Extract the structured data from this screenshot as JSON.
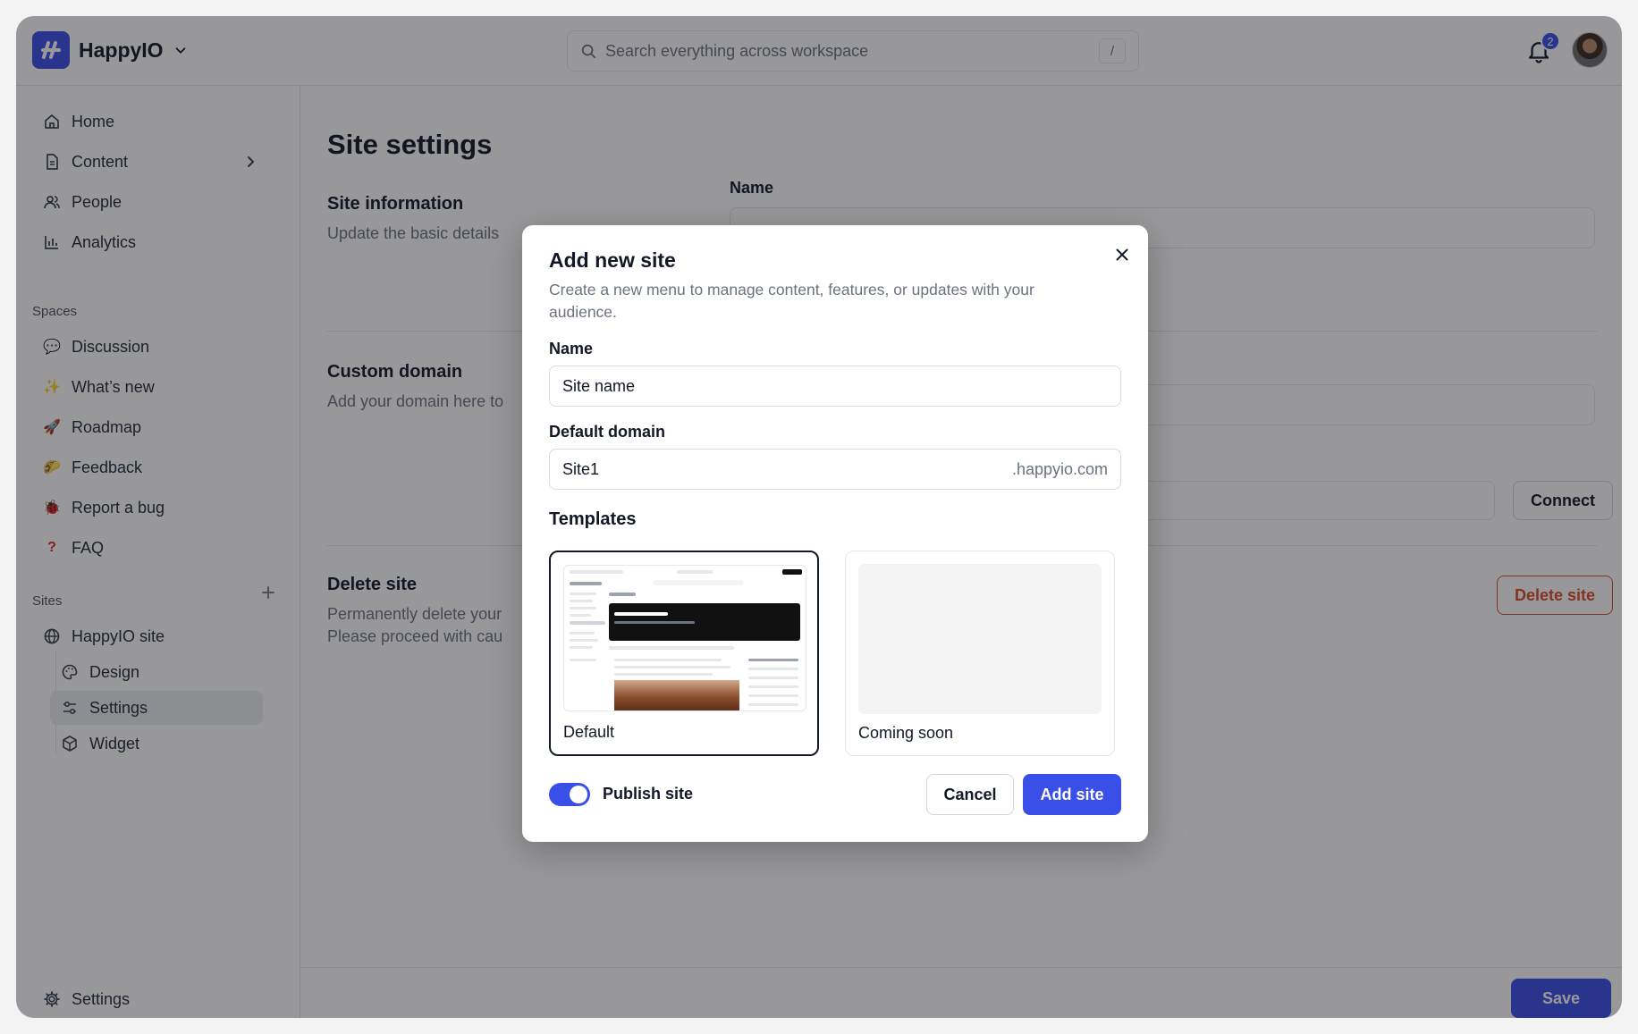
{
  "app": {
    "name": "HappyIO"
  },
  "search": {
    "placeholder": "Search everything across workspace",
    "shortcut": "/"
  },
  "notifications": {
    "count": "2"
  },
  "sidebar": {
    "main_items": [
      {
        "label": "Home",
        "icon": "home-icon"
      },
      {
        "label": "Content",
        "icon": "document-icon"
      },
      {
        "label": "People",
        "icon": "people-icon"
      },
      {
        "label": "Analytics",
        "icon": "chart-icon"
      }
    ],
    "spaces_label": "Spaces",
    "spaces": [
      {
        "label": "Discussion",
        "icon": "speech-bubble-emoji"
      },
      {
        "label": "What’s new",
        "icon": "sparkle-emoji"
      },
      {
        "label": "Roadmap",
        "icon": "rocket-emoji"
      },
      {
        "label": "Feedback",
        "icon": "taco-emoji"
      },
      {
        "label": "Report a bug",
        "icon": "bug-emoji"
      },
      {
        "label": "FAQ",
        "icon": "question-emoji"
      }
    ],
    "sites_label": "Sites",
    "site": {
      "label": "HappyIO site"
    },
    "site_children": [
      {
        "label": "Design",
        "icon": "palette-icon"
      },
      {
        "label": "Settings",
        "icon": "sliders-icon"
      },
      {
        "label": "Widget",
        "icon": "cube-icon"
      }
    ],
    "settings_label": "Settings"
  },
  "main": {
    "title": "Site settings",
    "site_info": {
      "title": "Site information",
      "desc": "Update the basic details"
    },
    "name_label": "Name",
    "custom_domain": {
      "title": "Custom domain",
      "desc": "Add your domain here to"
    },
    "connect_label": "Connect",
    "delete": {
      "title": "Delete site",
      "desc_line1": "Permanently delete your",
      "desc_line2": "Please proceed with cau",
      "button": "Delete site"
    },
    "save_label": "Save"
  },
  "modal": {
    "title": "Add new site",
    "description": "Create a new menu to manage content, features, or updates with your audience.",
    "name_label": "Name",
    "name_placeholder": "Site name",
    "domain_label": "Default domain",
    "domain_value": "Site1",
    "domain_suffix": ".happyio.com",
    "templates_label": "Templates",
    "templates": [
      {
        "name": "Default",
        "selected": true
      },
      {
        "name": "Coming soon",
        "selected": false
      }
    ],
    "publish_label": "Publish site",
    "publish_on": true,
    "cancel_label": "Cancel",
    "add_label": "Add site"
  },
  "colors": {
    "accent": "#3a4ee8",
    "danger": "#dc4a2e"
  }
}
